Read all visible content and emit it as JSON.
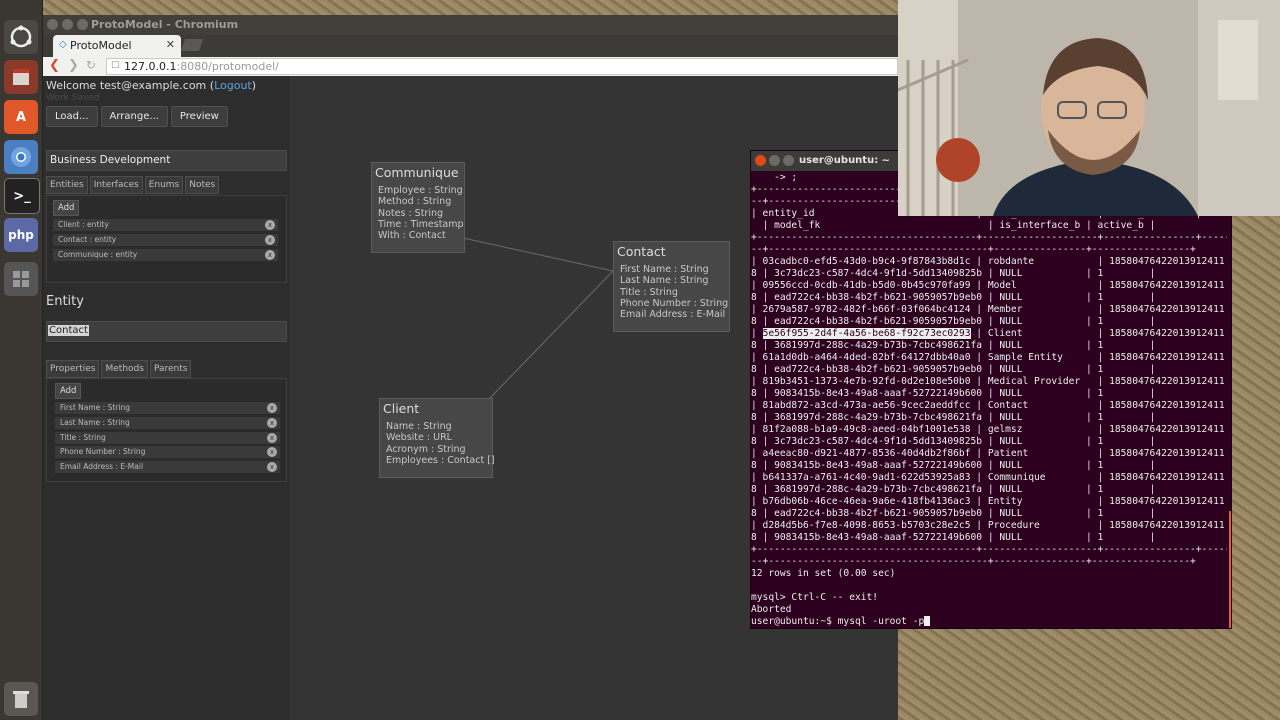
{
  "browser": {
    "window_title": "ProtoModel - Chromium",
    "tab_label": "ProtoModel",
    "url_host": "127.0.0.1",
    "url_path": ":8080/protomodel/"
  },
  "app": {
    "welcome_text": "Welcome test@example.com (",
    "logout_label": "Logout",
    "welcome_close": ")",
    "status_text": "Work Saved",
    "buttons": {
      "load": "Load...",
      "arrange": "Arrange...",
      "preview": "Preview"
    },
    "model_name": "Business Development",
    "model_tabs": [
      "Entities",
      "Interfaces",
      "Enums",
      "Notes"
    ],
    "add_label": "Add",
    "entities": [
      "Client : entity",
      "Contact : entity",
      "Communique : entity"
    ],
    "entity_heading": "Entity",
    "entity_name": "Contact",
    "entity_tabs": [
      "Properties",
      "Methods",
      "Parents"
    ],
    "properties": [
      "First Name : String",
      "Last Name : String",
      "Title : String",
      "Phone Number : String",
      "Email Address : E-Mail"
    ],
    "delete_glyph": "x"
  },
  "canvas": {
    "nodes": [
      {
        "title": "Communique",
        "fields": [
          "Employee : String",
          "Method : String",
          "Notes : String",
          "Time : Timestamp",
          "With : Contact"
        ]
      },
      {
        "title": "Contact",
        "fields": [
          "First Name : String",
          "Last Name : String",
          "Title : String",
          "Phone Number : String",
          "Email Address : E-Mail"
        ]
      },
      {
        "title": "Client",
        "fields": [
          "Name : String",
          "Website : URL",
          "Acronym : String",
          "Employees : Contact []"
        ]
      }
    ]
  },
  "terminal": {
    "title": "user@ubuntu: ~",
    "lines": [
      "    -> ;",
      "+--------------------------------------+--------------------+----------------+----------------",
      "--+--------------------------------------+----------------+-----------------+",
      "| entity_id                            | name_s             | owner_s        |",
      "  | model_fk                             | is_interface_b | active_b |",
      "+--------------------------------------+--------------------+----------------+----------------",
      "--+--------------------------------------+----------------+-----------------+",
      "| 03cadbc0-efd5-43d0-b9c4-9f87843b8d1c | robdante           | 18580476422013912411",
      "8 | 3c73dc23-c587-4dc4-9f1d-5dd13409825b | NULL           | 1        |",
      "| 09556ccd-0cdb-41db-b5d0-0b45c970fa99 | Model              | 18580476422013912411",
      "8 | ead722c4-bb38-4b2f-b621-9059057b9eb0 | NULL           | 1        |",
      "| 2679a587-9782-482f-b66f-03f064bc4124 | Member             | 18580476422013912411",
      "8 | ead722c4-bb38-4b2f-b621-9059057b9eb0 | NULL           | 1        |",
      "| 5e56f955-2d4f-4a56-be68-f92c73ec0293 | Client             | 18580476422013912411",
      "8 | 3681997d-288c-4a29-b73b-7cbc498621fa | NULL           | 1        |",
      "| 61a1d0db-a464-4ded-82bf-64127dbb40a0 | Sample Entity      | 18580476422013912411",
      "8 | ead722c4-bb38-4b2f-b621-9059057b9eb0 | NULL           | 1        |",
      "| 819b3451-1373-4e7b-92fd-0d2e108e50b0 | Medical Provider   | 18580476422013912411",
      "8 | 9083415b-8e43-49a8-aaaf-52722149b600 | NULL           | 1        |",
      "| 81abd872-a3cd-473a-ae56-9cec2aeddfcc | Contact            | 18580476422013912411",
      "8 | 3681997d-288c-4a29-b73b-7cbc498621fa | NULL           | 1        |",
      "| 81f2a088-b1a9-49c8-aeed-04bf1001e538 | gelmsz             | 18580476422013912411",
      "8 | 3c73dc23-c587-4dc4-9f1d-5dd13409825b | NULL           | 1        |",
      "| a4eeac80-d921-4877-8536-40d4db2f86bf | Patient            | 18580476422013912411",
      "8 | 9083415b-8e43-49a8-aaaf-52722149b600 | NULL           | 1        |",
      "| b641337a-a761-4c40-9ad1-622d53925a83 | Communique         | 18580476422013912411",
      "8 | 3681997d-288c-4a29-b73b-7cbc498621fa | NULL           | 1        |",
      "| b76db06b-46ce-46ea-9a6e-418fb4136ac3 | Entity             | 18580476422013912411",
      "8 | ead722c4-bb38-4b2f-b621-9059057b9eb0 | NULL           | 1        |",
      "| d284d5b6-f7e8-4098-8653-b5703c28e2c5 | Procedure          | 18580476422013912411",
      "8 | 9083415b-8e43-49a8-aaaf-52722149b600 | NULL           | 1        |",
      "+--------------------------------------+--------------------+----------------+----------------",
      "--+--------------------------------------+----------------+-----------------+",
      "12 rows in set (0.00 sec)",
      "",
      "mysql> Ctrl-C -- exit!",
      "Aborted",
      "user@ubuntu:~$ mysql -uroot -p"
    ],
    "highlight": "5e56f955-2d4f-4a56-be68-f92c73ec0293"
  }
}
